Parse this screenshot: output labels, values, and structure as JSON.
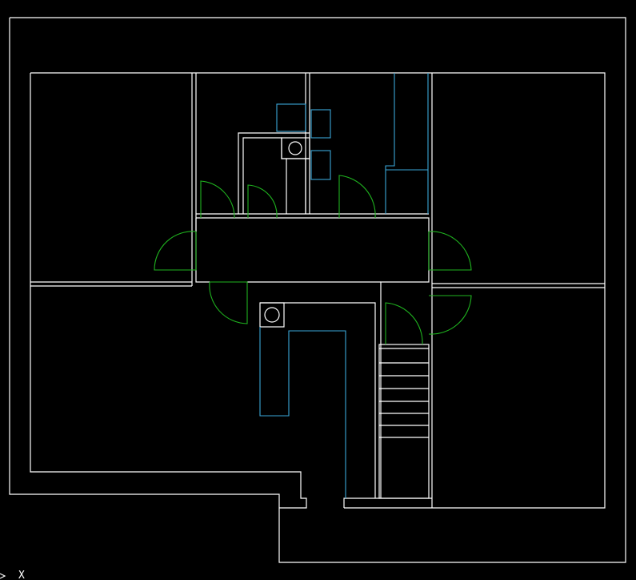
{
  "colors": {
    "background": "#000000",
    "walls": "#ffffff",
    "fixtures": "#3aa6d8",
    "doors": "#1fb31f"
  },
  "ucs_icon": {
    "axis_label": "X"
  }
}
